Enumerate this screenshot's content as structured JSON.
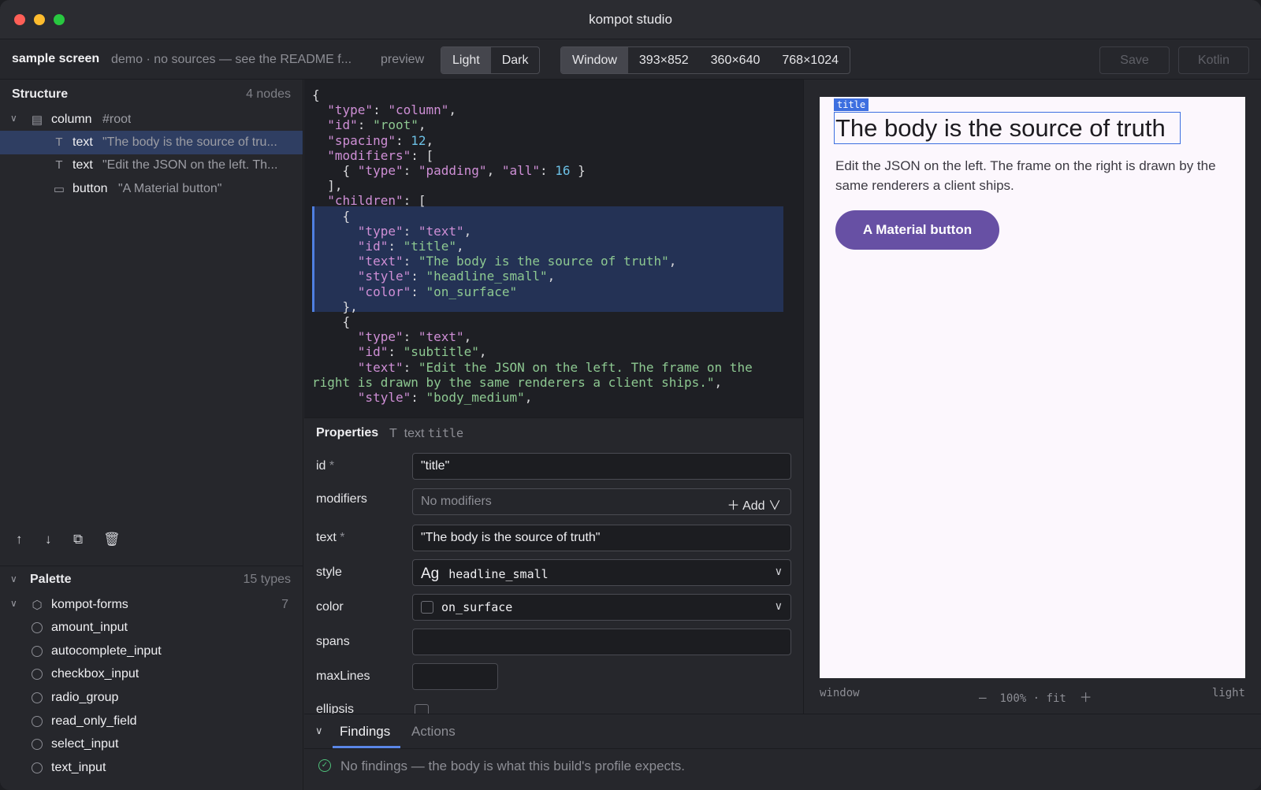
{
  "window": {
    "title": "kompot studio"
  },
  "toolbar": {
    "screen_name": "sample screen",
    "subtitle": "demo · no sources — see the README f...",
    "preview_label": "preview",
    "theme_options": [
      "Light",
      "Dark"
    ],
    "theme_selected": "Light",
    "size_options": [
      "Window",
      "393×852",
      "360×640",
      "768×1024"
    ],
    "size_selected": "Window",
    "save_label": "Save",
    "kotlin_label": "Kotlin"
  },
  "structure": {
    "title": "Structure",
    "count": "4 nodes",
    "nodes": [
      {
        "kind": "column",
        "label": "#root",
        "icon": "column-icon"
      },
      {
        "kind": "text",
        "label": "\"The body is the source of tru...",
        "icon": "text-icon",
        "selected": true
      },
      {
        "kind": "text",
        "label": "\"Edit the JSON on the left. Th...",
        "icon": "text-icon"
      },
      {
        "kind": "button",
        "label": "\"A Material button\"",
        "icon": "button-icon"
      }
    ]
  },
  "palette": {
    "title": "Palette",
    "count": "15 types",
    "group": {
      "name": "kompot-forms",
      "count": "7"
    },
    "items": [
      "amount_input",
      "autocomplete_input",
      "checkbox_input",
      "radio_group",
      "read_only_field",
      "select_input",
      "text_input"
    ]
  },
  "properties": {
    "title": "Properties",
    "kind": "text",
    "node_id": "title",
    "fields": {
      "id": {
        "label": "id",
        "value": "\"title\""
      },
      "modifiers": {
        "label": "modifiers",
        "value": "No modifiers",
        "add_label": "Add"
      },
      "text": {
        "label": "text",
        "value": "\"The body is the source of truth\""
      },
      "style": {
        "label": "style",
        "value": "headline_small",
        "glyph": "Ag"
      },
      "color": {
        "label": "color",
        "value": "on_surface"
      },
      "spans": {
        "label": "spans",
        "value": ""
      },
      "maxLines": {
        "label": "maxLines",
        "value": ""
      },
      "ellipsis": {
        "label": "ellipsis"
      }
    },
    "required_mark": "*"
  },
  "preview": {
    "selection_tag": "title",
    "title": "The body is the source of truth",
    "body": "Edit the JSON on the left. The frame on the right is drawn by the same renderers a client ships.",
    "button": "A Material button",
    "footer": {
      "left": "window",
      "zoom": "100%",
      "fit": "fit",
      "right": "light"
    },
    "colors": {
      "primary": "#6750a4",
      "surface": "#fcf7fd",
      "selection": "#3d6fe0"
    }
  },
  "bottom": {
    "tabs": [
      "Findings",
      "Actions"
    ],
    "active_tab": "Findings",
    "message": "No findings — the body is what this build's profile expects."
  }
}
